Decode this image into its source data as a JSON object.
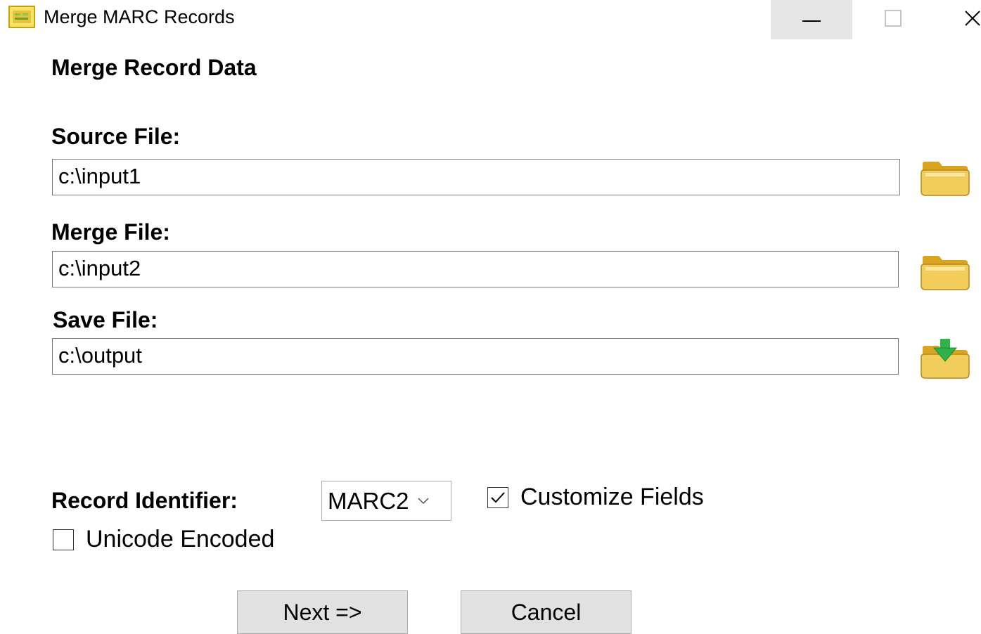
{
  "window": {
    "title": "Merge MARC Records",
    "controls": {
      "minimize": "minimize-icon",
      "maximize": "maximize-icon",
      "close": "close-icon"
    }
  },
  "heading": "Merge Record Data",
  "source": {
    "label": "Source File:",
    "value": "c:\\input1",
    "browse_icon": "folder-open-icon"
  },
  "merge": {
    "label": "Merge File:",
    "value": "c:\\input2",
    "browse_icon": "folder-open-icon"
  },
  "save": {
    "label": "Save File:",
    "value": "c:\\output",
    "browse_icon": "folder-save-icon"
  },
  "record_identifier": {
    "label": "Record Identifier:",
    "selected": "MARC2"
  },
  "customize_fields": {
    "label": "Customize Fields",
    "checked": true
  },
  "unicode_encoded": {
    "label": "Unicode Encoded",
    "checked": false
  },
  "buttons": {
    "next": "Next =>",
    "cancel": "Cancel"
  },
  "colors": {
    "folder": "#f2cd5c",
    "folder_dark": "#d9a520",
    "arrow_green": "#2fb24a",
    "minimize_bg": "#e5e5e5",
    "button_bg": "#e1e1e1"
  }
}
